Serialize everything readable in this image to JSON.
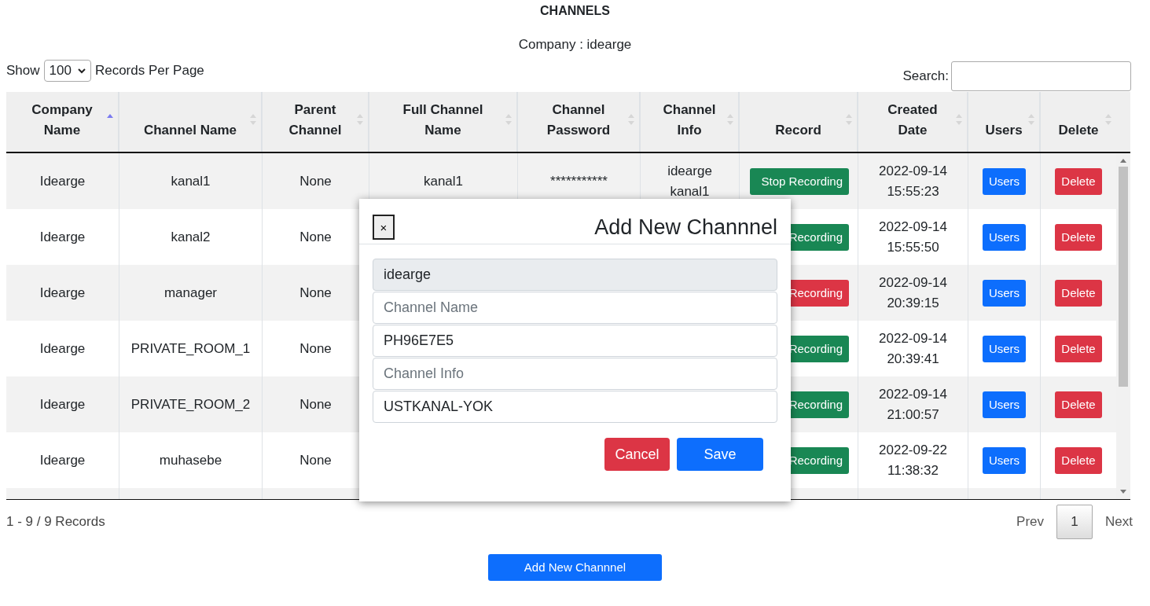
{
  "title": "CHANNELS",
  "company_line": "Company : idearge",
  "length_menu": {
    "before": "Show",
    "value": "100",
    "after": "Records Per Page"
  },
  "search": {
    "label": "Search:"
  },
  "table": {
    "columns": [
      {
        "label": "Company Name",
        "sorted_ascending": true
      },
      {
        "label": "Channel Name",
        "sorted_ascending": false
      },
      {
        "label": "Parent Channel",
        "sorted_ascending": false
      },
      {
        "label": "Full Channel Name",
        "sorted_ascending": false
      },
      {
        "label": "Channel Password",
        "sorted_ascending": false
      },
      {
        "label": "Channel Info",
        "sorted_ascending": false
      },
      {
        "label": "Record",
        "sorted_ascending": false
      },
      {
        "label": "Created Date",
        "sorted_ascending": false
      },
      {
        "label": "Users",
        "sorted_ascending": false
      },
      {
        "label": "Delete",
        "sorted_ascending": false
      }
    ],
    "rows": [
      {
        "company": "Idearge",
        "channel_name": "kanal1",
        "parent_channel": "None",
        "full_channel_name": "kanal1",
        "channel_password": "***********",
        "channel_info": "idearge kanal1",
        "record": {
          "label": "Stop Recording",
          "color": "#198754"
        },
        "created_date": "2022-09-14 15:55:23",
        "users": "Users",
        "delete": "Delete"
      },
      {
        "company": "Idearge",
        "channel_name": "kanal2",
        "parent_channel": "None",
        "record": {
          "label": "Recording",
          "color": "#198754"
        },
        "created_date": "2022-09-14 15:55:50",
        "users": "Users",
        "delete": "Delete"
      },
      {
        "company": "Idearge",
        "channel_name": "manager",
        "parent_channel": "None",
        "record": {
          "label": "Recording",
          "color": "#dc3545"
        },
        "created_date": "2022-09-14 20:39:15",
        "users": "Users",
        "delete": "Delete"
      },
      {
        "company": "Idearge",
        "channel_name": "PRIVATE_ROOM_1",
        "parent_channel": "None",
        "record": {
          "label": "Recording",
          "color": "#198754"
        },
        "created_date": "2022-09-14 20:39:41",
        "users": "Users",
        "delete": "Delete"
      },
      {
        "company": "Idearge",
        "channel_name": "PRIVATE_ROOM_2",
        "parent_channel": "None",
        "record": {
          "label": "Recording",
          "color": "#198754"
        },
        "created_date": "2022-09-14 21:00:57",
        "users": "Users",
        "delete": "Delete"
      },
      {
        "company": "Idearge",
        "channel_name": "muhasebe",
        "parent_channel": "None",
        "record": {
          "label": "Recording",
          "color": "#198754"
        },
        "created_date": "2022-09-22 11:38:32",
        "users": "Users",
        "delete": "Delete"
      }
    ]
  },
  "info": "1 - 9 / 9 Records",
  "pagination": {
    "prev": "Prev",
    "pages": [
      {
        "label": "1",
        "selected": true
      }
    ],
    "next": "Next"
  },
  "add_button": "Add New Channnel",
  "modal": {
    "close": "×",
    "title": "Add New Channnel",
    "fields": [
      {
        "value": "idearge",
        "disabled": true
      },
      {
        "placeholder": "Channel Name",
        "disabled": false
      },
      {
        "value": "PH96E7E5",
        "disabled": false
      },
      {
        "placeholder": "Channel Info",
        "disabled": false
      },
      {
        "value": "USTKANAL-YOK",
        "disabled": false
      }
    ],
    "cancel": "Cancel",
    "save": "Save"
  }
}
